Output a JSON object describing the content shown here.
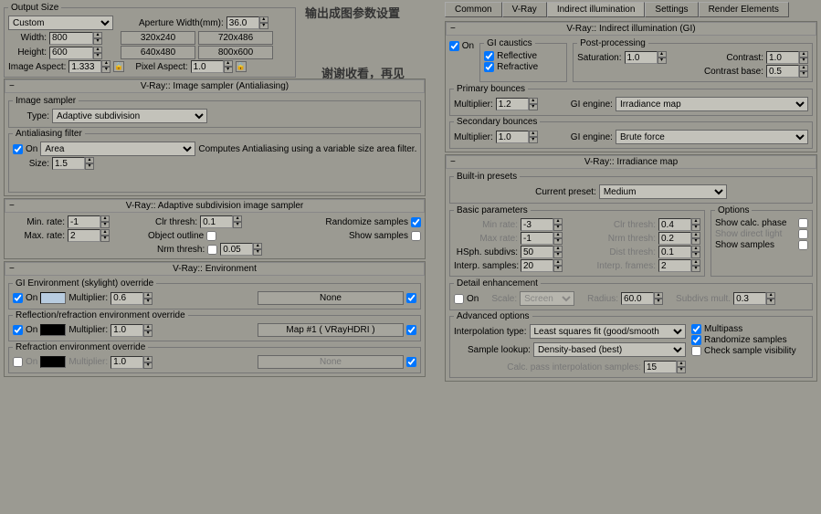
{
  "annotations": {
    "a1": "输出成图参数设置",
    "a2": "谢谢收看，再见"
  },
  "outputSize": {
    "legend": "Output Size",
    "sizeMode": "Custom",
    "apertureLabel": "Aperture Width(mm):",
    "aperture": "36.0",
    "widthLabel": "Width:",
    "width": "800",
    "heightLabel": "Height:",
    "height": "600",
    "preset1": "320x240",
    "preset2": "720x486",
    "preset3": "640x480",
    "preset4": "800x600",
    "imgAspectLabel": "Image Aspect:",
    "imgAspect": "1.333",
    "pixAspectLabel": "Pixel Aspect:",
    "pixAspect": "1.0"
  },
  "imageSampler": {
    "title": "V-Ray:: Image sampler (Antialiasing)",
    "samplerLegend": "Image sampler",
    "typeLabel": "Type:",
    "type": "Adaptive subdivision",
    "aaLegend": "Antialiasing filter",
    "onLabel": "On",
    "filter": "Area",
    "desc": "Computes Antialiasing using a variable size area filter.",
    "sizeLabel": "Size:",
    "size": "1.5"
  },
  "adaptiveSub": {
    "title": "V-Ray:: Adaptive subdivision image sampler",
    "minRateLabel": "Min. rate:",
    "minRate": "-1",
    "maxRateLabel": "Max. rate:",
    "maxRate": "2",
    "clrThreshLabel": "Clr thresh:",
    "clrThresh": "0.1",
    "objOutlineLabel": "Object outline",
    "nrmThreshLabel": "Nrm thresh:",
    "nrmThresh": "0.05",
    "randLabel": "Randomize samples",
    "showLabel": "Show samples"
  },
  "environment": {
    "title": "V-Ray:: Environment",
    "giLegend": "GI Environment (skylight) override",
    "onLabel": "On",
    "multLabel": "Multiplier:",
    "giColor": "#b8cce0",
    "giMult": "0.6",
    "giMap": "None",
    "reflLegend": "Reflection/refraction environment override",
    "reflColor": "#000000",
    "reflMult": "1.0",
    "reflMap": "Map #1   ( VRayHDRI )",
    "refrLegend": "Refraction environment override",
    "refrColor": "#000000",
    "refrMult": "1.0",
    "refrMap": "None"
  },
  "tabs": [
    "Common",
    "V-Ray",
    "Indirect illumination",
    "Settings",
    "Render Elements"
  ],
  "gi": {
    "title": "V-Ray:: Indirect illumination (GI)",
    "onLabel": "On",
    "causticsLegend": "GI caustics",
    "reflective": "Reflective",
    "refractive": "Refractive",
    "postLegend": "Post-processing",
    "satLabel": "Saturation:",
    "sat": "1.0",
    "contLabel": "Contrast:",
    "cont": "1.0",
    "cbaseLabel": "Contrast base:",
    "cbase": "0.5",
    "primaryLegend": "Primary bounces",
    "multLabel": "Multiplier:",
    "primMult": "1.2",
    "engineLabel": "GI engine:",
    "primEngine": "Irradiance map",
    "secondaryLegend": "Secondary bounces",
    "secMult": "1.0",
    "secEngine": "Brute force"
  },
  "irr": {
    "title": "V-Ray:: Irradiance map",
    "presetsLegend": "Built-in presets",
    "curPresetLabel": "Current preset:",
    "curPreset": "Medium",
    "basicLegend": "Basic parameters",
    "minRateL": "Min rate:",
    "minRate": "-3",
    "clrL": "Clr thresh:",
    "clr": "0.4",
    "maxRateL": "Max rate:",
    "maxRate": "-1",
    "nrmL": "Nrm thresh:",
    "nrm": "0.2",
    "hsphL": "HSph. subdivs:",
    "hsph": "50",
    "distL": "Dist thresh:",
    "dist": "0.1",
    "interpL": "Interp. samples:",
    "interp": "20",
    "iframesL": "Interp. frames:",
    "iframes": "2",
    "optionsLegend": "Options",
    "showPhase": "Show calc. phase",
    "showDirect": "Show direct light",
    "showSamples": "Show samples",
    "detailLegend": "Detail enhancement",
    "onL": "On",
    "scaleL": "Scale:",
    "scale": "Screen",
    "radiusL": "Radius:",
    "radius": "60.0",
    "subMultL": "Subdivs mult.",
    "subMult": "0.3",
    "advLegend": "Advanced options",
    "interpTypeL": "Interpolation type:",
    "interpType": "Least squares fit (good/smooth",
    "lookupL": "Sample lookup:",
    "lookup": "Density-based (best)",
    "multipass": "Multipass",
    "randomize": "Randomize samples",
    "checkVis": "Check sample visibility",
    "calcPassL": "Calc. pass interpolation samples:",
    "calcPass": "15"
  }
}
